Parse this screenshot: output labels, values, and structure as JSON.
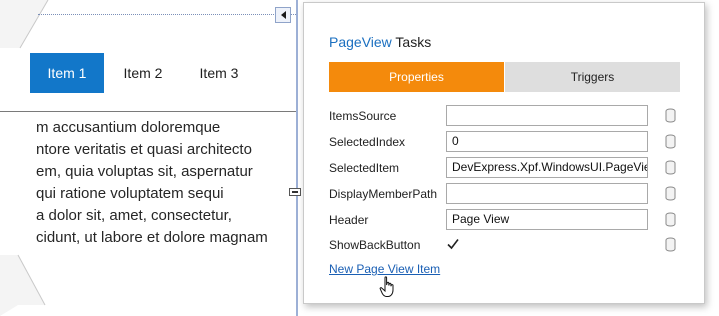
{
  "designer": {
    "tabs": [
      {
        "label": "Item 1",
        "active": true
      },
      {
        "label": "Item 2",
        "active": false
      },
      {
        "label": "Item 3",
        "active": false
      }
    ],
    "content_lines": [
      "m accusantium doloremque",
      "ntore veritatis et quasi architecto",
      "em, quia voluptas sit, aspernatur",
      "qui ratione voluptatem sequi",
      "a dolor sit, amet, consectetur,",
      "cidunt, ut labore et dolore magnam"
    ],
    "active_tab_color": "#1277c9"
  },
  "panel": {
    "title_accent": "PageView",
    "title_rest": " Tasks",
    "tabs": {
      "properties": "Properties",
      "triggers": "Triggers"
    },
    "active_tab_color": "#f48a0c",
    "props": [
      {
        "label": "ItemsSource",
        "value": ""
      },
      {
        "label": "SelectedIndex",
        "value": "0"
      },
      {
        "label": "SelectedItem",
        "value": "DevExpress.Xpf.WindowsUI.PageView"
      },
      {
        "label": "DisplayMemberPath",
        "value": ""
      },
      {
        "label": "Header",
        "value": "Page View"
      },
      {
        "label": "ShowBackButton",
        "checked": true
      }
    ],
    "link": "New Page View Item",
    "icons": {
      "binding": "database-icon",
      "collapse": "chevron-left-icon",
      "cursor": "hand-pointer-icon",
      "check": "checkmark-icon"
    }
  }
}
